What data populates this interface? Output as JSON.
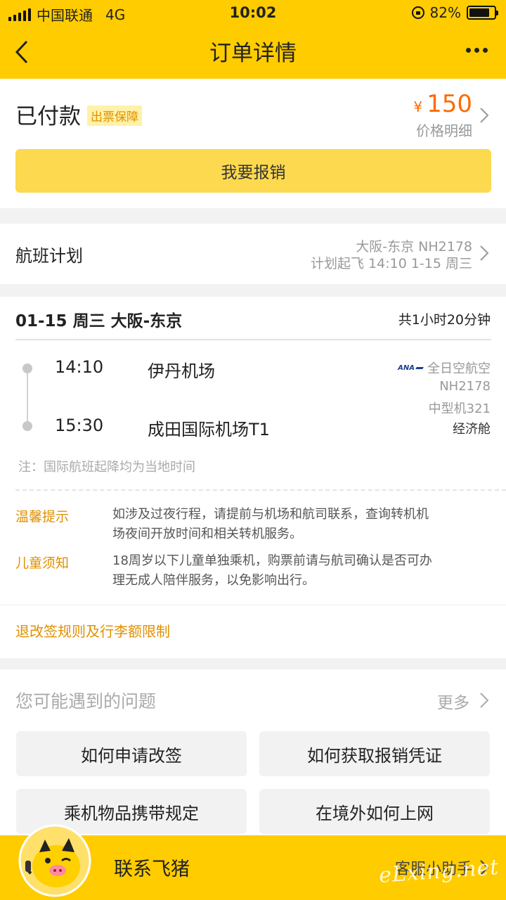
{
  "status_bar": {
    "carrier": "中国联通",
    "network": "4G",
    "time": "10:02",
    "battery": "82%",
    "battery_level": 0.82
  },
  "nav": {
    "title": "订单详情"
  },
  "order": {
    "status": "已付款",
    "badge": "出票保障",
    "currency": "¥",
    "price": "150",
    "price_detail": "价格明细",
    "reimburse_button": "我要报销"
  },
  "plan": {
    "label": "航班计划",
    "route": "大阪-东京 NH2178",
    "departure": "计划起飞 14:10 1-15 周三"
  },
  "flight": {
    "header": "01-15 周三 大阪-东京",
    "duration": "共1小时20分钟",
    "dep_time": "14:10",
    "dep_airport": "伊丹机场",
    "arr_time": "15:30",
    "arr_airport": "成田国际机场T1",
    "airline_logo": "ANA",
    "airline": "全日空航空",
    "flight_no": "NH2178",
    "aircraft": "中型机321",
    "cabin": "经济舱",
    "note": "注：国际航班起降均为当地时间"
  },
  "tips": [
    {
      "key": "温馨提示",
      "line1": "如涉及过夜行程，请提前与机场和航司联系，查询转机机",
      "line2": "场夜间开放时间和相关转机服务。"
    },
    {
      "key": "儿童须知",
      "line1": "18周岁以下儿童单独乘机，购票前请与航司确认是否可办",
      "line2": "理无成人陪伴服务，以免影响出行。"
    }
  ],
  "rules_link": "退改签规则及行李额限制",
  "questions": {
    "title": "您可能遇到的问题",
    "more": "更多",
    "items": [
      "如何申请改签",
      "如何获取报销凭证",
      "乘机物品携带规定",
      "在境外如何上网"
    ]
  },
  "bottom": {
    "contact": "联系飞猪",
    "helper": "客服小助手"
  },
  "watermark": "eLxing.net",
  "colors": {
    "brand_yellow": "#ffcc00",
    "button_yellow": "#fcd94e",
    "price_orange": "#ff6a00",
    "tip_orange": "#e09000"
  }
}
